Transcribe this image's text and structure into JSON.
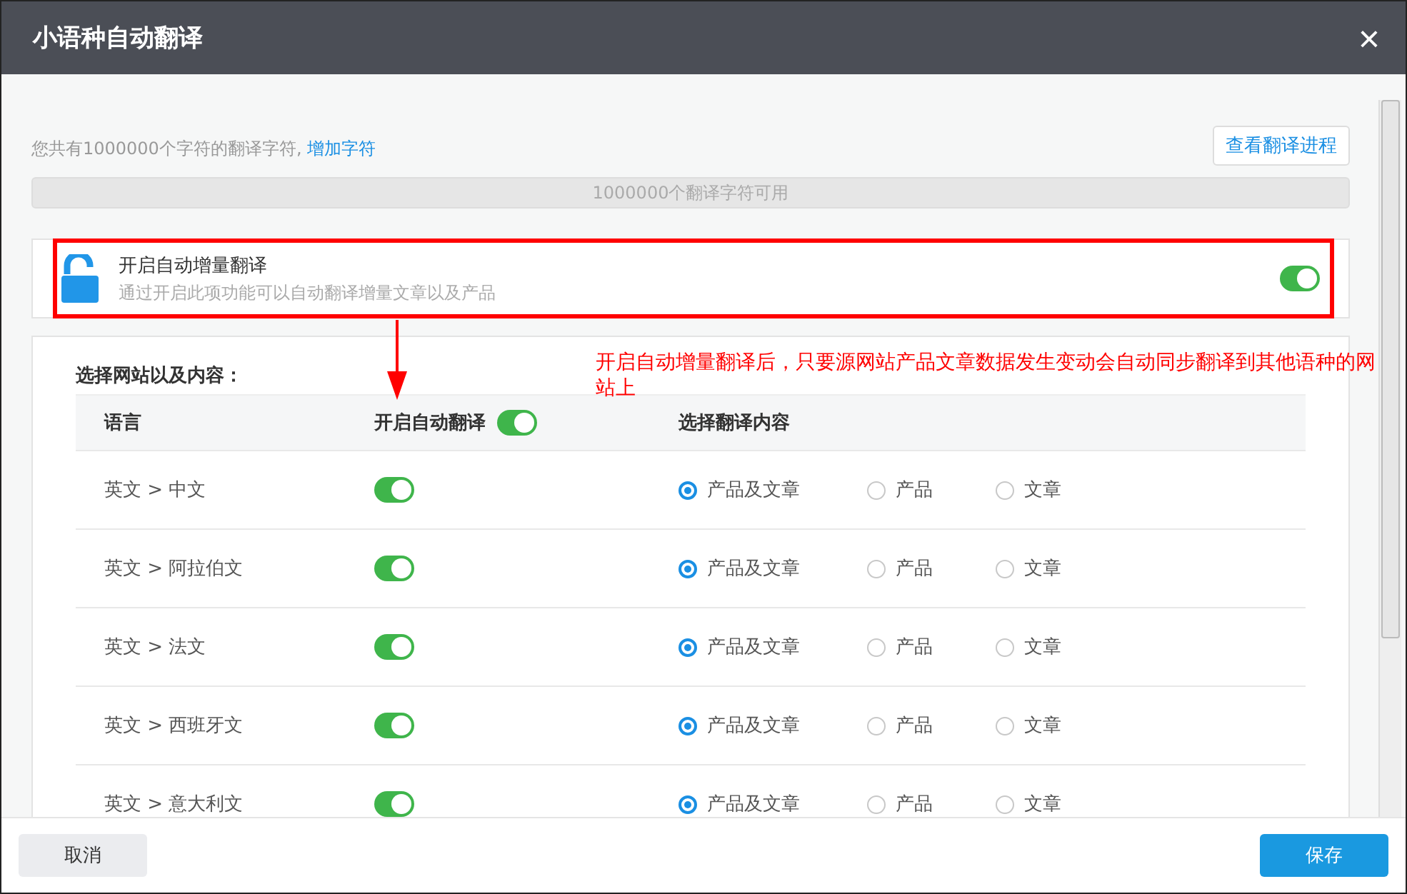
{
  "window": {
    "title": "小语种自动翻译",
    "close": "×"
  },
  "quota": {
    "text": "您共有1000000个字符的翻译字符,",
    "link": "增加字符",
    "progress_button": "查看翻译进程",
    "bar_text": "1000000个翻译字符可用"
  },
  "incremental": {
    "title": "开启自动增量翻译",
    "description": "通过开启此项功能可以自动翻译增量文章以及产品",
    "on": true
  },
  "annotation": {
    "text": "开启自动增量翻译后，只要源网站产品文章数据发生变动会自动同步翻译到其他语种的网站上"
  },
  "section_title": "选择网站以及内容：",
  "table": {
    "columns": [
      {
        "label": "语言"
      },
      {
        "label": "开启自动翻译",
        "on": true
      },
      {
        "label": "选择翻译内容"
      }
    ],
    "rows": [
      {
        "language": "英文 > 中文",
        "on": true,
        "options": [
          {
            "label": "产品及文章",
            "selected": true
          },
          {
            "label": "产品",
            "selected": false
          },
          {
            "label": "文章",
            "selected": false
          }
        ]
      },
      {
        "language": "英文 > 阿拉伯文",
        "on": true,
        "options": [
          {
            "label": "产品及文章",
            "selected": true
          },
          {
            "label": "产品",
            "selected": false
          },
          {
            "label": "文章",
            "selected": false
          }
        ]
      },
      {
        "language": "英文 > 法文",
        "on": true,
        "options": [
          {
            "label": "产品及文章",
            "selected": true
          },
          {
            "label": "产品",
            "selected": false
          },
          {
            "label": "文章",
            "selected": false
          }
        ]
      },
      {
        "language": "英文 > 西班牙文",
        "on": true,
        "options": [
          {
            "label": "产品及文章",
            "selected": true
          },
          {
            "label": "产品",
            "selected": false
          },
          {
            "label": "文章",
            "selected": false
          }
        ]
      },
      {
        "language": "英文 > 意大利文",
        "on": true,
        "options": [
          {
            "label": "产品及文章",
            "selected": true
          },
          {
            "label": "产品",
            "selected": false
          },
          {
            "label": "文章",
            "selected": false
          }
        ]
      }
    ]
  },
  "buttons": {
    "cancel": "取消",
    "save": "保存"
  }
}
